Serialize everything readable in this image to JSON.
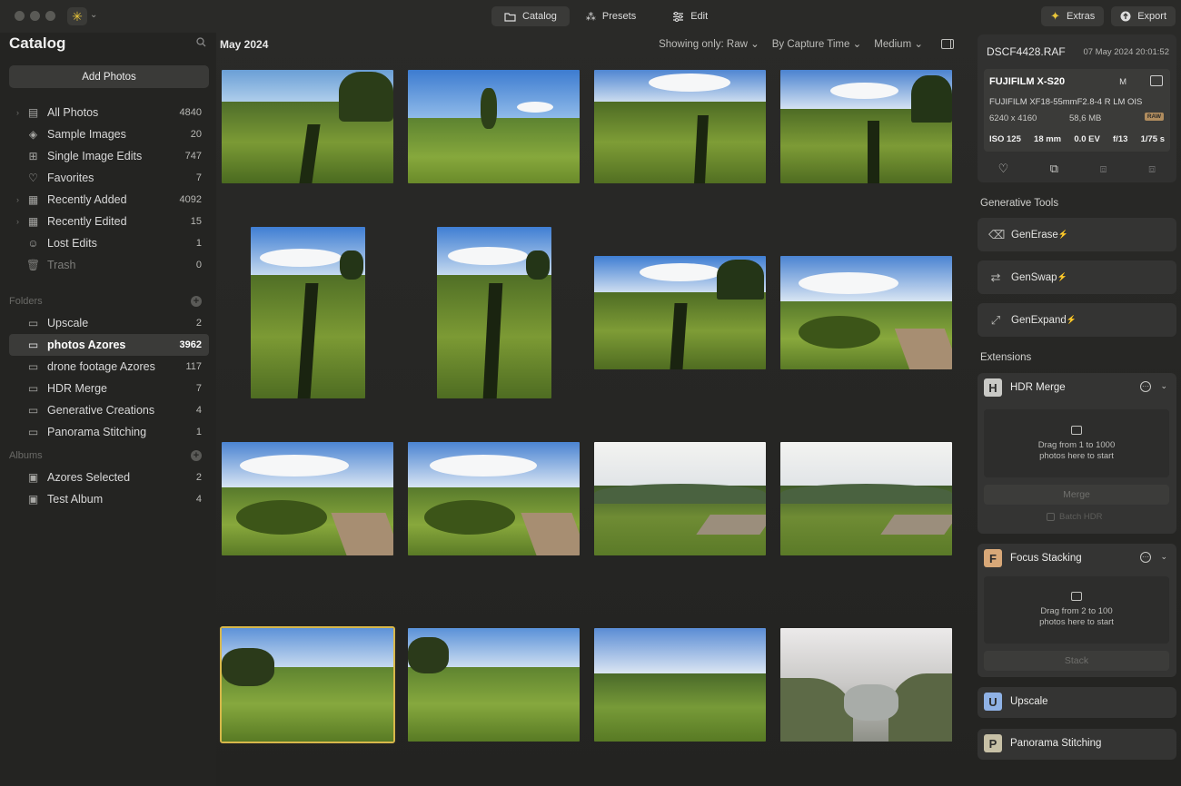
{
  "window": {
    "controls": [
      "close",
      "minimize",
      "zoom"
    ]
  },
  "topnav": {
    "tabs": [
      {
        "label": "Catalog",
        "icon": "folder-icon",
        "active": true
      },
      {
        "label": "Presets",
        "icon": "sparkle-icon",
        "active": false
      },
      {
        "label": "Edit",
        "icon": "sliders-icon",
        "active": false
      }
    ],
    "extras_label": "Extras",
    "export_label": "Export"
  },
  "sidebar": {
    "title": "Catalog",
    "add_photos_label": "Add Photos",
    "library": [
      {
        "label": "All Photos",
        "count": "4840",
        "icon": "photos-icon",
        "expandable": true
      },
      {
        "label": "Sample Images",
        "count": "20",
        "icon": "graduation-cap-icon"
      },
      {
        "label": "Single Image Edits",
        "count": "747",
        "icon": "grid-icon"
      },
      {
        "label": "Favorites",
        "count": "7",
        "icon": "heart-icon"
      },
      {
        "label": "Recently Added",
        "count": "4092",
        "icon": "calendar-plus-icon",
        "expandable": true
      },
      {
        "label": "Recently Edited",
        "count": "15",
        "icon": "calendar-edit-icon",
        "expandable": true
      },
      {
        "label": "Lost Edits",
        "count": "1",
        "icon": "lost-edits-icon"
      },
      {
        "label": "Trash",
        "count": "0",
        "icon": "trash-icon"
      }
    ],
    "folders_heading": "Folders",
    "folders": [
      {
        "label": "Upscale",
        "count": "2"
      },
      {
        "label": "photos Azores",
        "count": "3962",
        "selected": true
      },
      {
        "label": "drone footage Azores",
        "count": "117"
      },
      {
        "label": "HDR Merge",
        "count": "7"
      },
      {
        "label": "Generative Creations",
        "count": "4"
      },
      {
        "label": "Panorama Stitching",
        "count": "1"
      }
    ],
    "albums_heading": "Albums",
    "albums": [
      {
        "label": "Azores Selected",
        "count": "2"
      },
      {
        "label": "Test Album",
        "count": "4"
      }
    ]
  },
  "main": {
    "title": "May 2024",
    "filter_raw": "Showing only: Raw",
    "sort": "By Capture Time",
    "size": "Medium"
  },
  "info": {
    "filename": "DSCF4428.RAF",
    "date": "07 May 2024 20:01:52",
    "camera": "FUJIFILM X-S20",
    "mode": "M",
    "lens": "FUJIFILM XF18-55mmF2.8-4 R LM OIS",
    "resolution": "6240 x 4160",
    "filesize": "58,6 MB",
    "raw_badge": "RAW",
    "iso": "ISO 125",
    "focal": "18 mm",
    "ev": "0.0 EV",
    "aperture": "f/13",
    "shutter": "1/75 s"
  },
  "generative": {
    "heading": "Generative Tools",
    "tools": [
      {
        "label": "GenErase",
        "icon": "eraser-icon"
      },
      {
        "label": "GenSwap",
        "icon": "swap-icon"
      },
      {
        "label": "GenExpand",
        "icon": "expand-icon"
      }
    ],
    "bolt": "⚡"
  },
  "extensions": {
    "heading": "Extensions",
    "hdr": {
      "badge": "H",
      "title": "HDR Merge",
      "drop_line1": "Drag from 1 to 1000",
      "drop_line2": "photos here to start",
      "action": "Merge",
      "batch": "Batch HDR"
    },
    "focus": {
      "badge": "F",
      "title": "Focus Stacking",
      "drop_line1": "Drag from 2 to 100",
      "drop_line2": "photos here to start",
      "action": "Stack"
    },
    "upscale": {
      "badge": "U",
      "title": "Upscale"
    },
    "panorama": {
      "badge": "P",
      "title": "Panorama Stitching"
    }
  },
  "colors": {
    "accent_yellow": "#e8c53a",
    "selection": "#d7b74a",
    "raw_badge": "#b08c5e"
  }
}
